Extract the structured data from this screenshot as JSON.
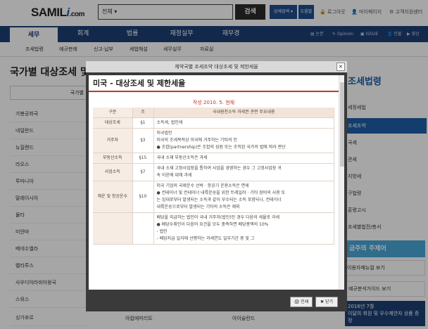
{
  "header": {
    "logo_main": "SAMIL",
    "logo_i": "i",
    "logo_com": ".com",
    "search_value": "전체 ▾",
    "search_btn": "검색",
    "adv_search": "상세검색 ▾",
    "help": "도움말",
    "logout": "로그아웃",
    "mypage": "마이페이지",
    "customer": "고객지원센터"
  },
  "nav": {
    "items": [
      "세무",
      "회계",
      "법률",
      "재정실무",
      "재무경"
    ],
    "right": [
      "논문",
      "Opinion",
      "ISSUE",
      "인물",
      "영상"
    ]
  },
  "subnav": [
    "조세법령",
    "예규판례",
    "신고·납부",
    "세법해설",
    "세무실무",
    "자료실"
  ],
  "page": {
    "title": "국가별 대상조세 및",
    "tab_label": "국가별"
  },
  "countries": [
    "가봉공화국",
    "네덜란드",
    "뉴질랜드",
    "라오스",
    "루마니아",
    "말레이시아",
    "몰타",
    "미얀마",
    "베네수엘라",
    "벨라루스",
    "사우디아라비아왕국",
    "스위스",
    "싱가포르"
  ],
  "bottom": [
    "아랍에미리트",
    "아이슬란드"
  ],
  "right": {
    "title": "조세법령",
    "menu": [
      "세정세법",
      "조세조약",
      "국세",
      "관세",
      "지방세",
      "구법령",
      "훈령고시",
      "조세별법전/총서"
    ],
    "banner1": "금주의 주제어",
    "banner2": "이용자매뉴얼 보기",
    "banner3": "예규분석가이드 보기",
    "banner4_l1": "2016년 7월",
    "banner4_l2": "이달의 회원 및 우수제안자 상품 증정"
  },
  "modal": {
    "head": "체약국별 조세조약 대상조세 및 제한세율",
    "close": "×",
    "doc_title": "미국 - 대상조세 및 제한세율",
    "doc_date": "작성 2010. 5. 현재",
    "col_headers": [
      "구분",
      "조",
      "국내원천소득 과세권 관련 주요내용"
    ],
    "rows": [
      {
        "c1": "대상조세",
        "c2": "§1",
        "lines": [
          "소득세, 법인세"
        ]
      },
      {
        "c1": "거주자",
        "c2": "§3",
        "lines": [
          "미국법인",
          "미국의 조세목적상 미국에 거주하는 기타의 인",
          "● 조합(partnership)은 조합의 성원 또는 조직된 국가의 법에 따라 판단"
        ]
      },
      {
        "c1": "부동산소득",
        "c2": "§15",
        "lines": [
          "국내 소재 부동산소득은 과세"
        ]
      },
      {
        "c1": "사업소득",
        "c2": "§7",
        "lines": [
          "국내 소재 고정사업장을 통하여 사업을 경영하는 경우 그 고정사업장 귀",
          "속 이윤에 대해 과세"
        ]
      },
      {
        "c1": "해운 및 항공운수",
        "c2": "§10",
        "lines": [
          "미국 기업의 국제운수 선박 · 항공기 운용소득은 면세",
          "● 컨테이너 및 컨테이너 내륙운송을 위한 트레일러 · 기타 장비의 사용 또",
          "   는 임대로부터 발생되는 소득과 같이 부수되는 소득 포함되나, 컨테이너",
          "   내륙운송으로부터 발생되는 기타의 소득은 제외"
        ]
      },
      {
        "c1": "",
        "c2": "",
        "lines": [
          "배당을 지급하는 법인이 국내 거주자(법인)인 경우 다음의 세율로 과세",
          "● 배당수취인이 다음의 요건을 모두 충족하면 배당총액의 10%",
          "   - 법인",
          "   - 배당지급 일자에 선행하는 과세연도 일부기간 중 및 그"
        ]
      }
    ],
    "print_btn": "인쇄",
    "close_btn": "닫기"
  }
}
